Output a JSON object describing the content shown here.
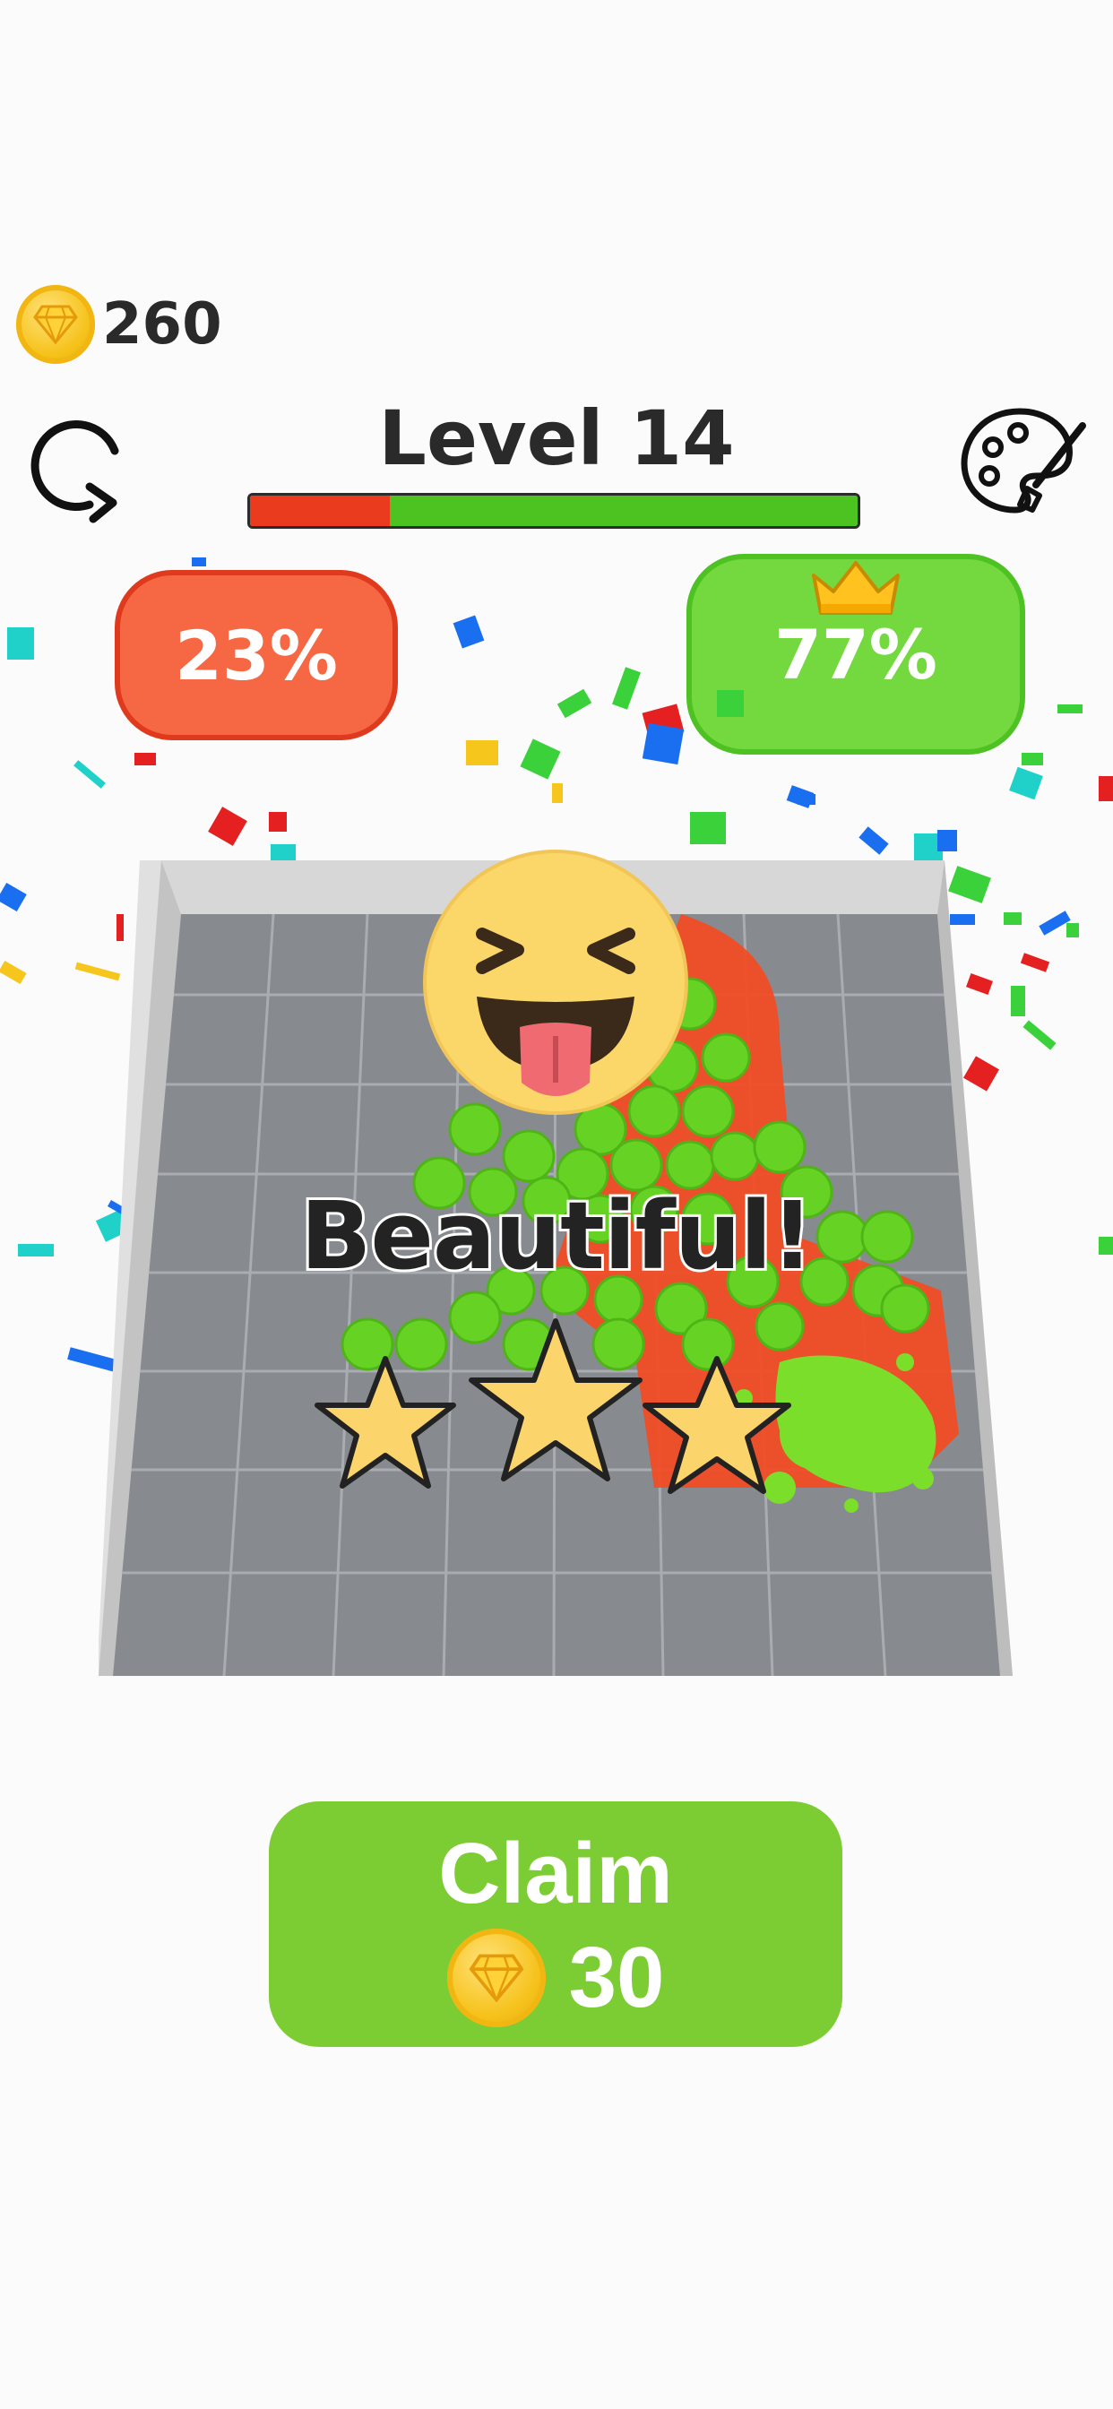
{
  "hud": {
    "coins": "260",
    "level_title": "Level 14",
    "progress": {
      "red_fraction": 0.23,
      "green_fraction": 0.77
    }
  },
  "scores": {
    "red_label": "23%",
    "green_label": "77%"
  },
  "result": {
    "message": "Beautiful!",
    "stars_earned": 3
  },
  "claim": {
    "label": "Claim",
    "amount": "30"
  },
  "colors": {
    "red_team": "#ea3b1f",
    "green_team": "#4cc321",
    "claim_button": "#7ccd34",
    "coin_gold": "#f6c21b"
  },
  "icons": [
    "coin-icon",
    "restart-icon",
    "palette-icon",
    "crown-icon",
    "emoji-icon",
    "star-icon"
  ]
}
